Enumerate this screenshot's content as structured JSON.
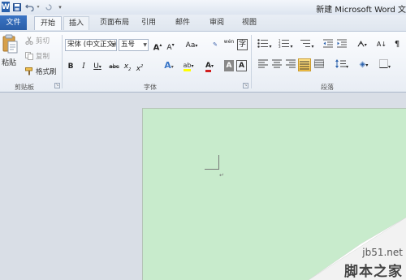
{
  "window": {
    "title": "新建 Microsoft Word 文"
  },
  "quick_access": {
    "icons": [
      "word-icon",
      "save-icon",
      "undo-icon",
      "redo-icon",
      "customize-icon"
    ]
  },
  "tabs": [
    {
      "label": "文件"
    },
    {
      "label": "开始"
    },
    {
      "label": "插入"
    },
    {
      "label": "页面布局"
    },
    {
      "label": "引用"
    },
    {
      "label": "邮件"
    },
    {
      "label": "审阅"
    },
    {
      "label": "视图"
    }
  ],
  "clipboard": {
    "paste": "粘贴",
    "cut": "剪切",
    "copy": "复制",
    "format_painter": "格式刷",
    "group_label": "剪贴板"
  },
  "font": {
    "font_name": "宋体 (中文正文)",
    "font_size": "五号",
    "grow": "A",
    "shrink": "A",
    "change_case": "Aa",
    "bold": "B",
    "italic": "I",
    "underline": "U",
    "strikethrough": "abc",
    "subscript": "x",
    "superscript": "x",
    "font_color": "A",
    "char_shading": "A",
    "char_border": "A",
    "pinyin": "wén",
    "group_label": "字体"
  },
  "paragraph": {
    "group_label": "段落"
  },
  "watermark": {
    "site": "jb51.net",
    "brand": "脚本之家"
  },
  "colors": {
    "page_bg": "#c8ebcc",
    "file_tab": "#2b62ad",
    "active_align": "#fcc84a",
    "font_red": "#d11f1f",
    "highlight_yellow": "#ffff00"
  }
}
